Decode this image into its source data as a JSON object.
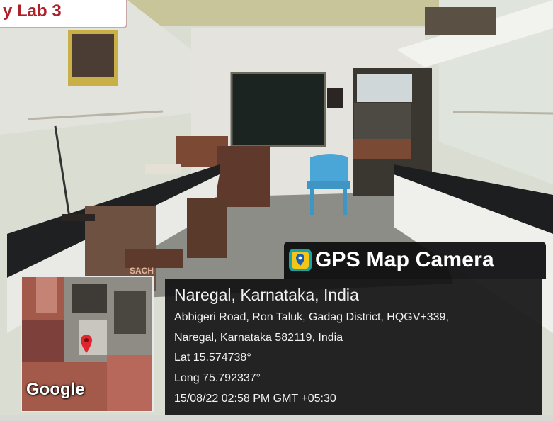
{
  "photo": {
    "subject": "laboratory room with black-topped benches, a blackboard and a blue plastic chair",
    "colors": {
      "wall": "#d7dccf",
      "ceiling_band": "#c9c59a",
      "bench_top": "#222426",
      "chair": "#4aa6d6",
      "floor": "#8f8f86",
      "label_red": "#b0202a"
    }
  },
  "title_tag": {
    "text": "y Lab 3"
  },
  "bench_sign": {
    "text": "SACH"
  },
  "gps_overlay": {
    "app_name": "GPS Map Camera",
    "app_icon": "map-pin-icon",
    "place": "Naregal, Karnataka, India",
    "address_line_1": "Abbigeri Road, Ron Taluk, Gadag District, HQGV+339,",
    "address_line_2": "Naregal, Karnataka 582119, India",
    "latitude": "Lat 15.574738°",
    "longitude": "Long 75.792337°",
    "datetime": "15/08/22 02:58 PM GMT +05:30",
    "map_brand": "Google",
    "marker_icon": "location-marker-icon"
  }
}
